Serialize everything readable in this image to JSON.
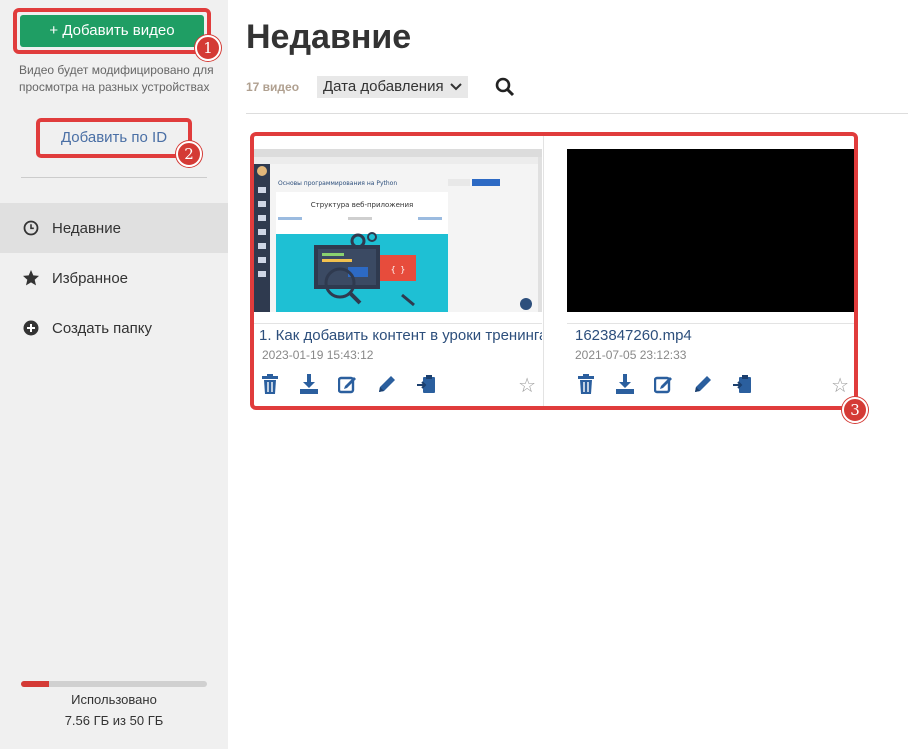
{
  "sidebar": {
    "add_video_label": "+ Добавить видео",
    "hint": "Видео будет модифицировано для просмотра на разных устройствах",
    "add_by_id_label": "Добавить по ID",
    "nav": [
      {
        "label": "Недавние",
        "icon": "clock-icon"
      },
      {
        "label": "Избранное",
        "icon": "star-icon"
      },
      {
        "label": "Создать папку",
        "icon": "plus-circle-icon"
      }
    ],
    "usage": {
      "label": "Использовано",
      "value": "7.56 ГБ из 50 ГБ",
      "fraction": 0.15
    }
  },
  "callouts": {
    "one": "1",
    "two": "2",
    "three": "3"
  },
  "main": {
    "title": "Недавние",
    "count": "17 видео",
    "sort_label": "Дата добавления",
    "cards": [
      {
        "title": "1. Как добавить контент в уроки тренинга",
        "date": "2023-01-19 15:43:12"
      },
      {
        "title": "1623847260.mp4",
        "date": "2021-07-05 23:12:33"
      }
    ],
    "thumb_text": {
      "heading": "Основы программирования на Python",
      "slide_title": "Структура веб-приложения"
    }
  },
  "colors": {
    "accent_green": "#1f9e64",
    "callout_red": "#e03c3c",
    "link_blue": "#2d4f7c",
    "action_blue": "#2b5f9e"
  }
}
